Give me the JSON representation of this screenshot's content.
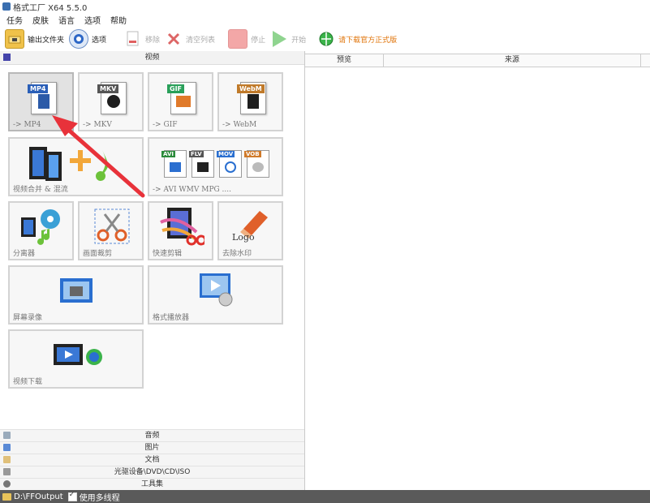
{
  "window": {
    "title": "格式工厂 X64 5.5.0"
  },
  "menu": [
    "任务",
    "皮肤",
    "语言",
    "选项",
    "帮助"
  ],
  "toolbar": {
    "output_folder": "输出文件夹",
    "options": "选项",
    "remove": "移除",
    "clear_list": "清空列表",
    "stop": "停止",
    "start": "开始",
    "download": "请下载官方正式版"
  },
  "colors": {
    "orange_text": "#e0740a",
    "status_bar": "#5a5a5a",
    "arrow": "#e8323a"
  },
  "video_section": {
    "title": "视频",
    "tiles": {
      "mp4": {
        "tag": "MP4",
        "caption": "-> MP4"
      },
      "mkv": {
        "tag": "MKV",
        "caption": "-> MKV"
      },
      "gif": {
        "tag": "GIF",
        "caption": "-> GIF"
      },
      "webm": {
        "tag": "WebM",
        "caption": "-> WebM"
      },
      "merge": {
        "caption": "视频合并 & 混流"
      },
      "avi": {
        "caption": "-> AVI WMV MPG ....",
        "tags": [
          "AVI",
          "FLV",
          "MOV",
          "VOB"
        ]
      },
      "splitter": {
        "caption": "分离器"
      },
      "crop": {
        "caption": "画面裁剪"
      },
      "quick_cut": {
        "caption": "快速剪辑"
      },
      "remove_watermark": {
        "caption": "去除水印",
        "logo_text": "Logo"
      },
      "screen_record": {
        "caption": "屏幕录像"
      },
      "player": {
        "caption": "格式播放器"
      },
      "download_video": {
        "caption": "视频下载"
      }
    }
  },
  "bottom_sections": [
    "音频",
    "图片",
    "文档",
    "光驱设备\\DVD\\CD\\ISO",
    "工具集"
  ],
  "task_list": {
    "columns": [
      "预览",
      "来源"
    ]
  },
  "status": {
    "output_path": "D:\\FFOutput",
    "multithread_label": "使用多线程",
    "multithread_checked": true
  }
}
